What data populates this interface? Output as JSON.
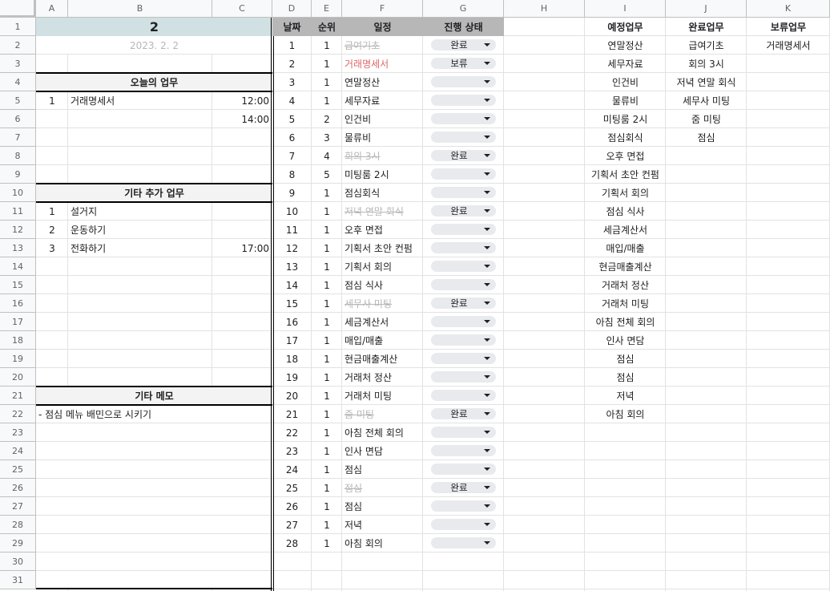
{
  "columns": [
    "A",
    "B",
    "C",
    "D",
    "E",
    "F",
    "G",
    "H",
    "I",
    "J",
    "K"
  ],
  "rows": [
    "1",
    "2",
    "3",
    "4",
    "5",
    "6",
    "7",
    "8",
    "9",
    "10",
    "11",
    "12",
    "13",
    "14",
    "15",
    "16",
    "17",
    "18",
    "19",
    "20",
    "21",
    "22",
    "23",
    "24",
    "25",
    "26",
    "27",
    "28",
    "29",
    "30",
    "31"
  ],
  "left": {
    "day": "2",
    "date": "2023. 2. 2",
    "today_header": "오늘의 업무",
    "today_tasks": [
      {
        "no": "1",
        "task": "거래명세서",
        "time": "12:00"
      },
      {
        "no": "",
        "task": "",
        "time": "14:00"
      }
    ],
    "extra_header": "기타 추가 업무",
    "extra_tasks": [
      {
        "no": "1",
        "task": "설거지",
        "time": ""
      },
      {
        "no": "2",
        "task": "운동하기",
        "time": ""
      },
      {
        "no": "3",
        "task": "전화하기",
        "time": "17:00"
      }
    ],
    "memo_header": "기타 메모",
    "memo_text": "- 점심 메뉴 배민으로 시키기"
  },
  "schedule": {
    "headers": {
      "date": "날짜",
      "rank": "순위",
      "item": "일정",
      "status": "진행 상태"
    },
    "rows": [
      {
        "date": "1",
        "rank": "1",
        "item": "급여기초",
        "status": "완료",
        "style": "strike"
      },
      {
        "date": "2",
        "rank": "1",
        "item": "거래명세서",
        "status": "보류",
        "style": "red"
      },
      {
        "date": "3",
        "rank": "1",
        "item": "연말정산",
        "status": "",
        "style": ""
      },
      {
        "date": "4",
        "rank": "1",
        "item": "세무자료",
        "status": "",
        "style": ""
      },
      {
        "date": "5",
        "rank": "2",
        "item": "인건비",
        "status": "",
        "style": ""
      },
      {
        "date": "6",
        "rank": "3",
        "item": "물류비",
        "status": "",
        "style": ""
      },
      {
        "date": "7",
        "rank": "4",
        "item": "회의 3시",
        "status": "완료",
        "style": "strike"
      },
      {
        "date": "8",
        "rank": "5",
        "item": "미팅룸 2시",
        "status": "",
        "style": ""
      },
      {
        "date": "9",
        "rank": "1",
        "item": "점심회식",
        "status": "",
        "style": ""
      },
      {
        "date": "10",
        "rank": "1",
        "item": "저녁 연말 회식",
        "status": "완료",
        "style": "strike"
      },
      {
        "date": "11",
        "rank": "1",
        "item": "오후 면접",
        "status": "",
        "style": ""
      },
      {
        "date": "12",
        "rank": "1",
        "item": "기획서 초안 컨펌",
        "status": "",
        "style": ""
      },
      {
        "date": "13",
        "rank": "1",
        "item": "기획서 회의",
        "status": "",
        "style": ""
      },
      {
        "date": "14",
        "rank": "1",
        "item": "점심 식사",
        "status": "",
        "style": ""
      },
      {
        "date": "15",
        "rank": "1",
        "item": "세무사 미팅",
        "status": "완료",
        "style": "strike"
      },
      {
        "date": "16",
        "rank": "1",
        "item": "세금계산서",
        "status": "",
        "style": ""
      },
      {
        "date": "17",
        "rank": "1",
        "item": "매입/매출",
        "status": "",
        "style": ""
      },
      {
        "date": "18",
        "rank": "1",
        "item": "현금매출계산",
        "status": "",
        "style": ""
      },
      {
        "date": "19",
        "rank": "1",
        "item": "거래처 정산",
        "status": "",
        "style": ""
      },
      {
        "date": "20",
        "rank": "1",
        "item": "거래처 미팅",
        "status": "",
        "style": ""
      },
      {
        "date": "21",
        "rank": "1",
        "item": "줌 미팅",
        "status": "완료",
        "style": "strike"
      },
      {
        "date": "22",
        "rank": "1",
        "item": "아침 전체 회의",
        "status": "",
        "style": ""
      },
      {
        "date": "23",
        "rank": "1",
        "item": "인사 면담",
        "status": "",
        "style": ""
      },
      {
        "date": "24",
        "rank": "1",
        "item": "점심",
        "status": "",
        "style": ""
      },
      {
        "date": "25",
        "rank": "1",
        "item": "점심",
        "status": "완료",
        "style": "strike"
      },
      {
        "date": "26",
        "rank": "1",
        "item": "점심",
        "status": "",
        "style": ""
      },
      {
        "date": "27",
        "rank": "1",
        "item": "저녁",
        "status": "",
        "style": ""
      },
      {
        "date": "28",
        "rank": "1",
        "item": "아침 회의",
        "status": "",
        "style": ""
      }
    ]
  },
  "summary": {
    "headers": {
      "planned": "예정업무",
      "done": "완료업무",
      "held": "보류업무"
    },
    "planned": [
      "연말정산",
      "세무자료",
      "인건비",
      "물류비",
      "미팅룸 2시",
      "점심회식",
      "오후 면접",
      "기획서 초안 컨펌",
      "기획서 회의",
      "점심 식사",
      "세금계산서",
      "매입/매출",
      "현금매출계산",
      "거래처 정산",
      "거래처 미팅",
      "아침 전체 회의",
      "인사 면담",
      "점심",
      "점심",
      "저녁",
      "아침 회의"
    ],
    "done": [
      "급여기초",
      "회의 3시",
      "저녁 연말 회식",
      "세무사 미팅",
      "줌 미팅",
      "점심"
    ],
    "held": [
      "거래명세서"
    ]
  },
  "colors": {
    "header_gray": "#b7b7b7",
    "title_fill": "#d0e0e3",
    "strike_gray": "#b7b7b7",
    "red_text": "#e06666",
    "chip": "#e8eaed"
  }
}
